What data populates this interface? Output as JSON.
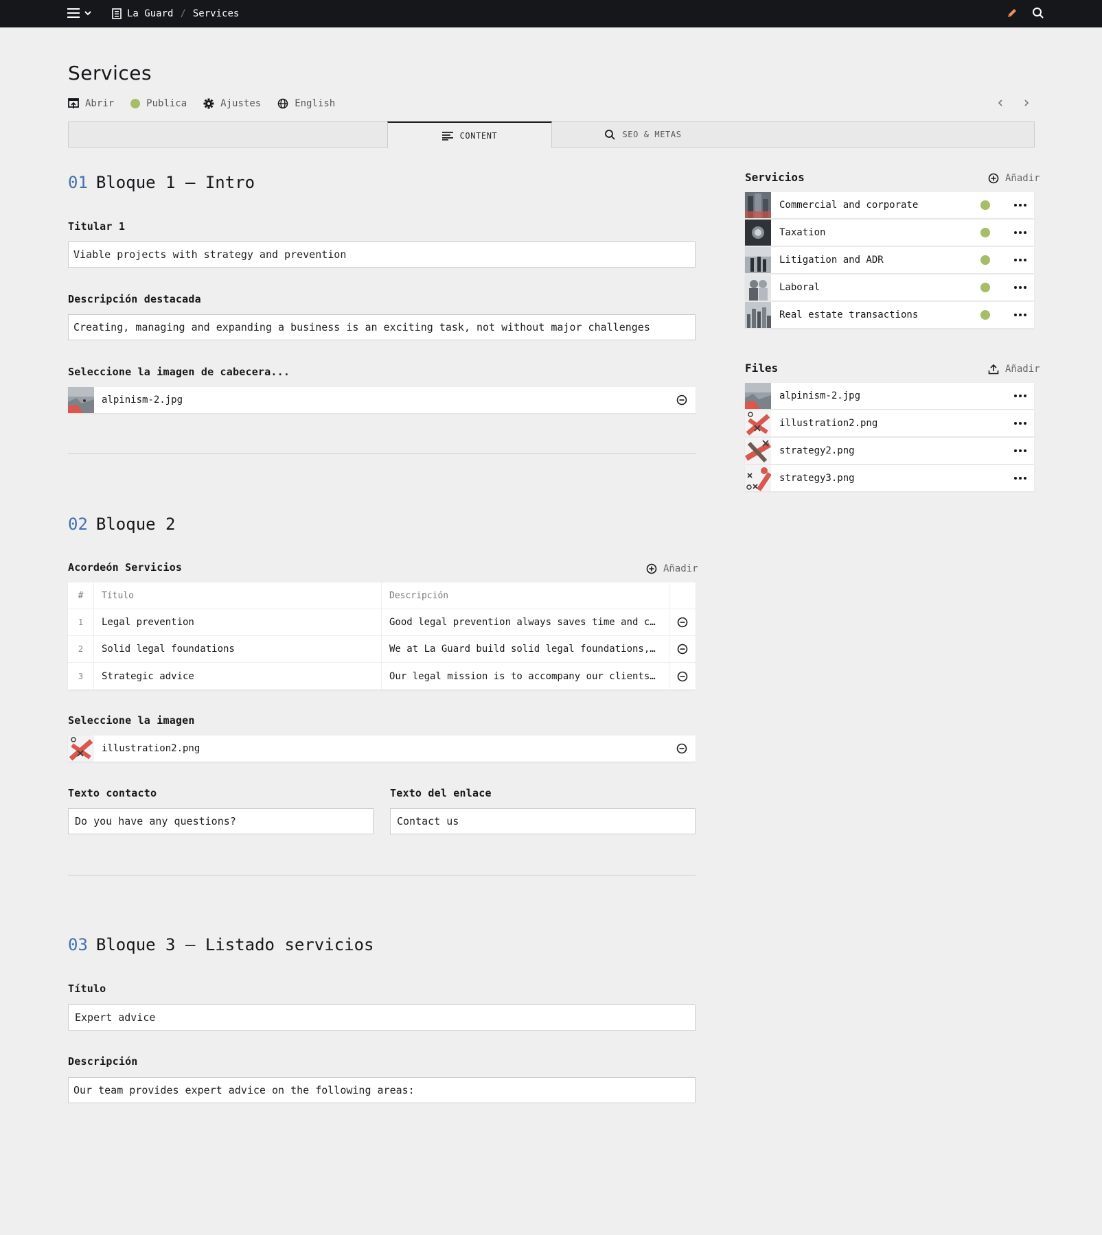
{
  "topbar": {
    "site": "La Guard",
    "separator": "/",
    "page": "Services"
  },
  "header": {
    "title": "Services",
    "options": {
      "open": "Abrir",
      "status": "Publica",
      "settings": "Ajustes",
      "language": "English"
    }
  },
  "tabs": {
    "content": "CONTENT",
    "seo": "SEO & METAS"
  },
  "block1": {
    "num": "01",
    "title": "Bloque 1 — Intro",
    "headline_label": "Titular 1",
    "headline_value": "Viable projects with strategy and prevention",
    "desc_label": "Descripción destacada",
    "desc_value": "Creating, managing and expanding a business is an exciting task, not without major challenges",
    "image_label": "Seleccione la imagen de cabecera...",
    "image_file": "alpinism-2.jpg"
  },
  "block2": {
    "num": "02",
    "title": "Bloque 2",
    "accordion_label": "Acordeón Servicios",
    "add_label": "Añadir",
    "table_headers": {
      "idx": "#",
      "title": "Título",
      "desc": "Descripción"
    },
    "rows": [
      {
        "idx": "1",
        "title": "Legal prevention",
        "desc": "Good legal prevention always saves time and cost, and e…"
      },
      {
        "idx": "2",
        "title": "Solid legal foundations",
        "desc": "We at La Guard build solid legal foundations, which are al…"
      },
      {
        "idx": "3",
        "title": "Strategic advice",
        "desc": "Our legal mission is to accompany our clients, either by h…"
      }
    ],
    "image_label": "Seleccione la imagen",
    "image_file": "illustration2.png",
    "contact_label": "Texto contacto",
    "contact_value": "Do you have any questions?",
    "link_label": "Texto del enlace",
    "link_value": "Contact us"
  },
  "block3": {
    "num": "03",
    "title": "Bloque 3 — Listado servicios",
    "title_label": "Título",
    "title_value": "Expert advice",
    "desc_label": "Descripción",
    "desc_value": "Our team provides expert advice on the following areas:"
  },
  "sidebar": {
    "services_label": "Servicios",
    "services_add": "Añadir",
    "services": [
      {
        "name": "Commercial and corporate",
        "status": "published"
      },
      {
        "name": "Taxation",
        "status": "published"
      },
      {
        "name": "Litigation and ADR",
        "status": "published"
      },
      {
        "name": "Laboral",
        "status": "published"
      },
      {
        "name": "Real estate transactions",
        "status": "published"
      }
    ],
    "files_label": "Files",
    "files_add": "Añadir",
    "files": [
      {
        "name": "alpinism-2.jpg"
      },
      {
        "name": "illustration2.png"
      },
      {
        "name": "strategy2.png"
      },
      {
        "name": "strategy3.png"
      }
    ]
  },
  "colors": {
    "topbar": "#16171a",
    "accent_number": "#4271ae",
    "status_published": "#a7bd68",
    "pencil": "#e8935a"
  }
}
